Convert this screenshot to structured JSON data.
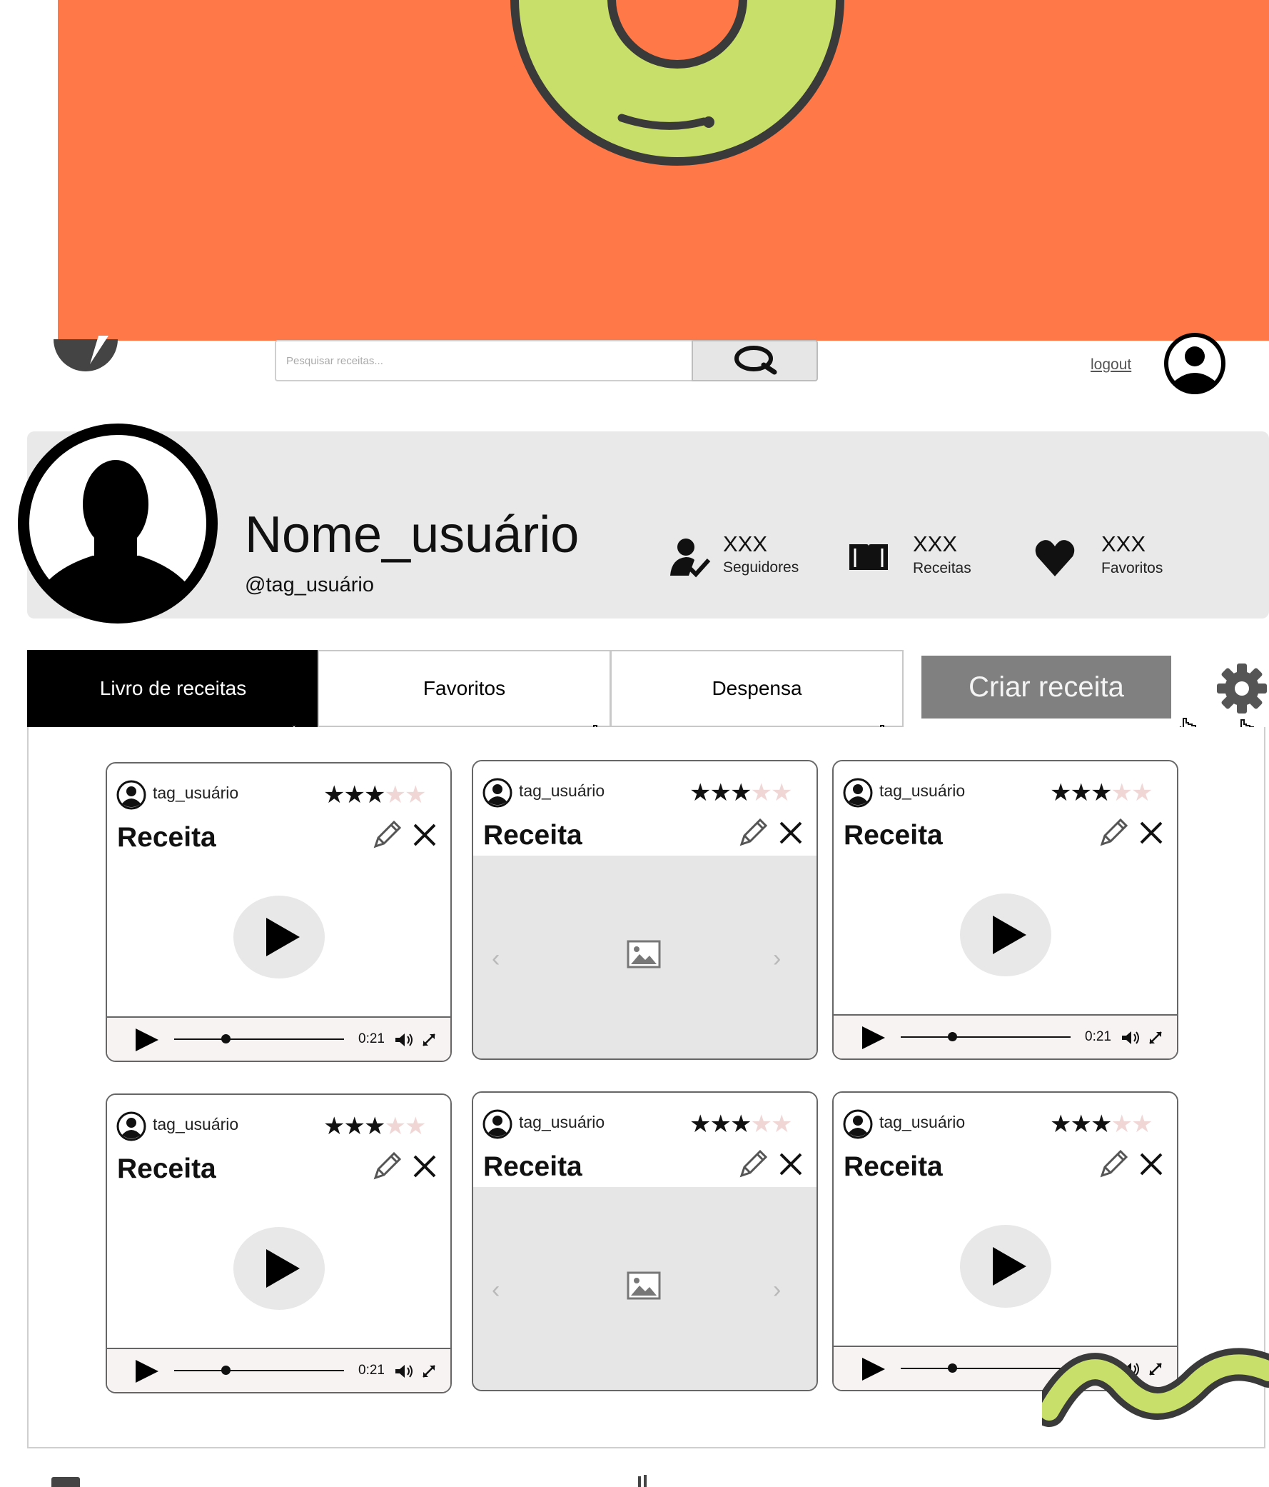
{
  "header": {
    "search_placeholder": "Pesquisar receitas...",
    "logout_label": "logout"
  },
  "profile": {
    "name": "Nome_usuário",
    "tag": "@tag_usuário",
    "stats": [
      {
        "value": "XXX",
        "label": "Seguidores",
        "icon": "user-check-icon"
      },
      {
        "value": "XXX",
        "label": "Receitas",
        "icon": "book-icon"
      },
      {
        "value": "XXX",
        "label": "Favoritos",
        "icon": "heart-icon"
      }
    ]
  },
  "tabs": [
    {
      "label": "Livro de receitas",
      "active": true
    },
    {
      "label": "Favoritos",
      "active": false
    },
    {
      "label": "Despensa",
      "active": false
    }
  ],
  "create_button_label": "Criar receita",
  "cards": [
    {
      "user": "tag_usuário",
      "title": "Receita",
      "media": "video",
      "time": "0:21",
      "rating": 3,
      "max_rating": 5
    },
    {
      "user": "tag_usuário",
      "title": "Receita",
      "media": "image",
      "rating": 3,
      "max_rating": 5
    },
    {
      "user": "tag_usuário",
      "title": "Receita",
      "media": "video",
      "time": "0:21",
      "rating": 3,
      "max_rating": 5
    },
    {
      "user": "tag_usuário",
      "title": "Receita",
      "media": "video",
      "time": "0:21",
      "rating": 3,
      "max_rating": 5
    },
    {
      "user": "tag_usuário",
      "title": "Receita",
      "media": "image",
      "rating": 3,
      "max_rating": 5
    },
    {
      "user": "tag_usuário",
      "title": "Receita",
      "media": "video",
      "time": "",
      "rating": 3,
      "max_rating": 5
    }
  ],
  "colors": {
    "banner": "#FF7848",
    "donut": "#C8E06A",
    "outline": "#3A3A3A",
    "tab_active": "#000000",
    "create_button": "#808080",
    "profile_bg": "#E9E9E9"
  }
}
